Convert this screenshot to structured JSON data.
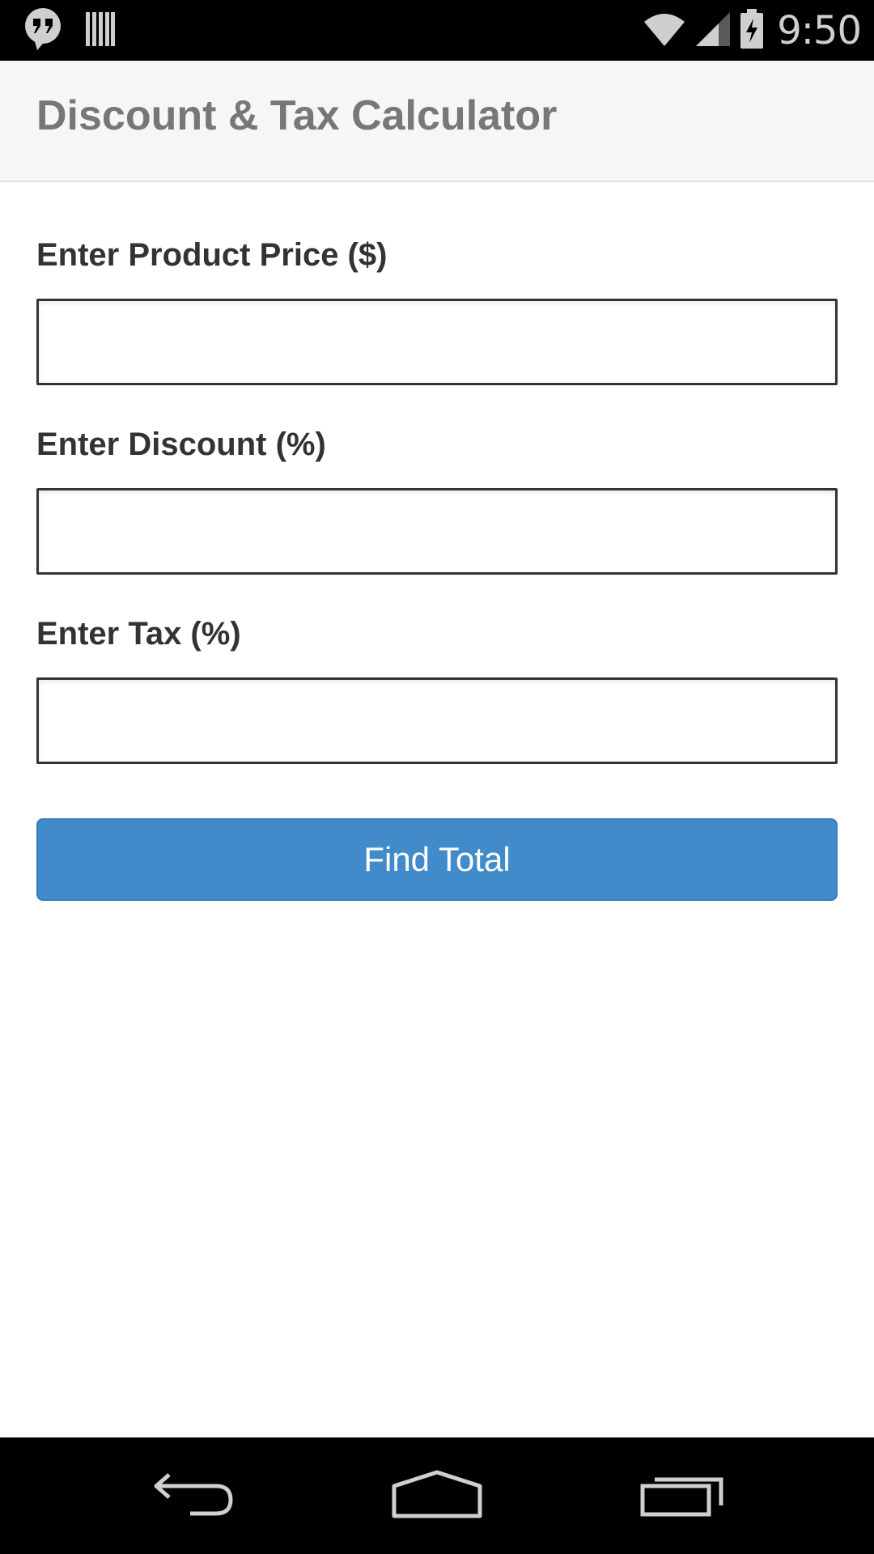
{
  "status_bar": {
    "time": "9:50",
    "icons": [
      "hangouts-icon",
      "barcode-icon",
      "wifi-icon",
      "cell-signal-icon",
      "battery-charging-icon"
    ]
  },
  "header": {
    "title": "Discount & Tax Calculator"
  },
  "form": {
    "fields": [
      {
        "label": "Enter Product Price ($)",
        "value": "",
        "placeholder": ""
      },
      {
        "label": "Enter Discount (%)",
        "value": "",
        "placeholder": ""
      },
      {
        "label": "Enter Tax (%)",
        "value": "",
        "placeholder": ""
      }
    ],
    "submit_label": "Find Total"
  },
  "nav_bar": {
    "icons": [
      "back-icon",
      "home-icon",
      "recents-icon"
    ]
  },
  "colors": {
    "status_bar_bg": "#000000",
    "header_bg": "#f6f6f6",
    "title_text": "#777777",
    "label_text": "#333333",
    "button_bg": "#428bca",
    "button_text": "#ffffff"
  }
}
